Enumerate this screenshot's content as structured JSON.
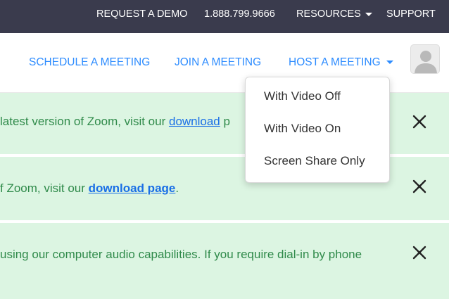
{
  "topbar": {
    "request_demo": "REQUEST A DEMO",
    "phone": "1.888.799.9666",
    "resources": "RESOURCES",
    "support": "SUPPORT"
  },
  "nav": {
    "schedule": "SCHEDULE A MEETING",
    "join": "JOIN A MEETING",
    "host": "HOST A MEETING",
    "avatar_icon": "user-avatar-icon"
  },
  "dropdown": {
    "items": [
      "With Video Off",
      "With Video On",
      "Screen Share Only"
    ]
  },
  "banners": [
    {
      "text_before": "latest version of Zoom, visit our ",
      "link": "download",
      "text_after": " p"
    },
    {
      "text_before": "f Zoom, visit our ",
      "link": "download page",
      "text_after": "."
    },
    {
      "text_before": "using our computer audio capabilities. If you require dial-in by phone",
      "link": "",
      "text_after": ""
    }
  ],
  "colors": {
    "topbar_bg": "#3a3b4d",
    "link_blue": "#2d8cff",
    "banner_bg": "#dcf5e2",
    "banner_text": "#2f8a4a"
  }
}
